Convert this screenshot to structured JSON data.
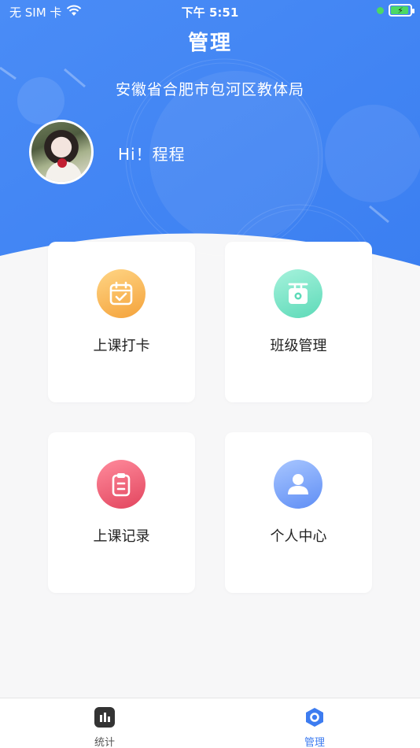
{
  "status_bar": {
    "carrier": "无 SIM 卡",
    "time": "下午 5:51"
  },
  "header": {
    "title": "管理",
    "organization": "安徽省合肥市包河区教体局",
    "greeting": "Hi！程程"
  },
  "menu": {
    "items": [
      {
        "label": "上课打卡",
        "icon": "calendar-check-icon",
        "color_from": "#ffd585",
        "color_to": "#f4a23a"
      },
      {
        "label": "班级管理",
        "icon": "projector-icon",
        "color_from": "#a6f2dc",
        "color_to": "#5ddab8"
      },
      {
        "label": "上课记录",
        "icon": "clipboard-icon",
        "color_from": "#ff8b9c",
        "color_to": "#e2455e"
      },
      {
        "label": "个人中心",
        "icon": "person-icon",
        "color_from": "#a8c6ff",
        "color_to": "#5f8ef5"
      }
    ]
  },
  "tabbar": {
    "items": [
      {
        "label": "统计",
        "icon": "bar-chart-icon",
        "active": false
      },
      {
        "label": "管理",
        "icon": "hexagon-settings-icon",
        "active": true
      }
    ]
  },
  "colors": {
    "header_blue": "#3f83f2",
    "active_tab": "#3d7cf0",
    "background": "#f7f7f8"
  }
}
